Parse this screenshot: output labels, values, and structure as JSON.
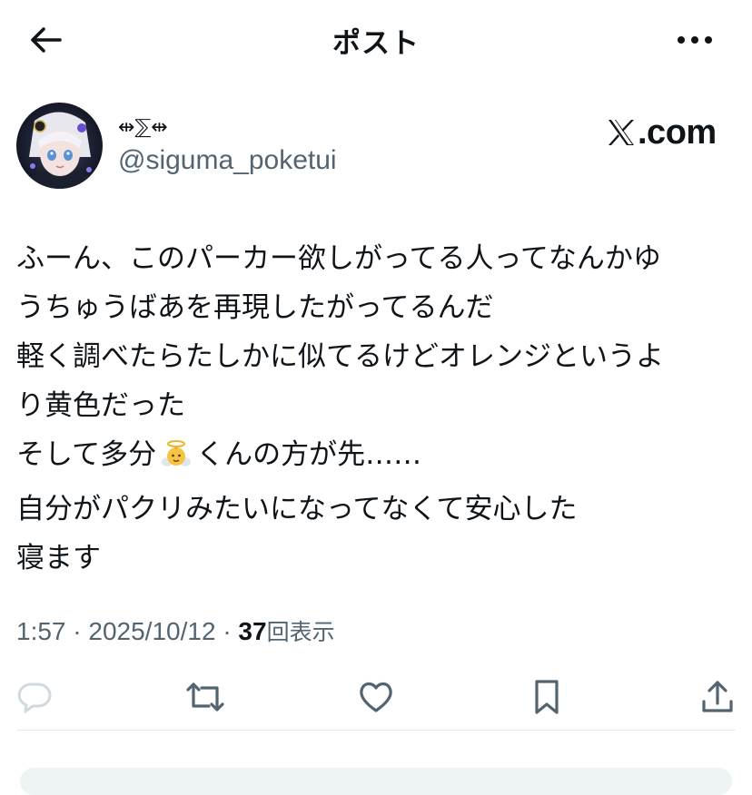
{
  "header": {
    "title": "ポスト",
    "back_icon": "arrow-left-icon",
    "more_icon": "more-horizontal-icon"
  },
  "author": {
    "display_name": "⇹⅀⇹",
    "handle": "@siguma_poketui",
    "avatar": "anime-character-avatar"
  },
  "brand": {
    "text": ".com",
    "logo_icon": "x-logo-icon"
  },
  "post": {
    "lines": [
      "ふーん、このパーカー欲しがってる人ってなんかゆ",
      "うちゅうばあを再現したがってるんだ",
      "軽く調べたらたしかに似てるけどオレンジというよ",
      "り黄色だった"
    ],
    "line5_before": "そして多分",
    "line5_emoji": "baby-angel-emoji",
    "line5_after": "くんの方が先……",
    "line6": "自分がパクリみたいになってなくて安心した",
    "line7": "寝ます"
  },
  "meta": {
    "time": "1:57",
    "sep1": "·",
    "date": "2025/10/12",
    "sep2": "·",
    "views": "37",
    "views_label": "回表示"
  },
  "actions": {
    "reply_icon": "reply-bubble-icon",
    "repost_icon": "repost-icon",
    "like_icon": "heart-icon",
    "bookmark_icon": "bookmark-icon",
    "share_icon": "share-icon"
  },
  "colors": {
    "text": "#0f1419",
    "secondary": "#536471",
    "divider": "#e7e9ea",
    "reply_icon_muted": "#cfd9de"
  }
}
